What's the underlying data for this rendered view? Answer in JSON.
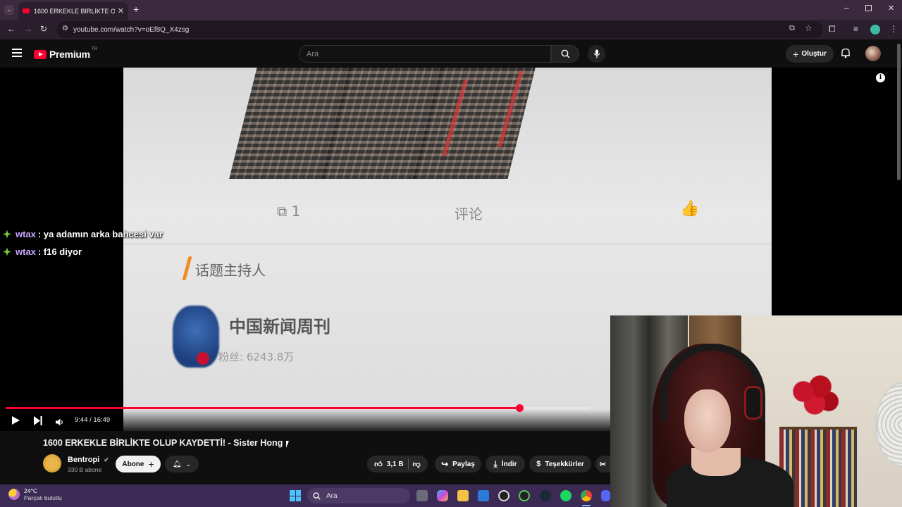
{
  "browser": {
    "tab_title": "1600 ERKEKLE BİRLİKTE OLUP KAYDETTİ! - Sister Hong",
    "url": "youtube.com/watch?v=oEf8Q_X4zsg"
  },
  "youtube": {
    "logo_text": "Premium",
    "logo_region": "TR",
    "search_placeholder": "Ara",
    "create_label": "Oluştur"
  },
  "video_overlay": {
    "cn_share": "1",
    "cn_comment": "评论",
    "cn_host": "话题主持人",
    "cn_source": "中国新闻周刊",
    "cn_followers": "粉丝: 6243.8万"
  },
  "player": {
    "time": "9:44 / 16:49",
    "progress": 0.88
  },
  "chat": [
    {
      "user": "wtax",
      "message": ": ya adamın arka bahcesi var"
    },
    {
      "user": "wtax",
      "message": ": f16 diyor"
    }
  ],
  "video": {
    "title": "1600 ERKEKLE BİRLİKTE OLUP KAYDETTİ! - Sister Hong",
    "channel": "Bentropi",
    "subscribers": "330 B abone",
    "subscribe_label": "Abone",
    "likes": "3,1 B",
    "share_label": "Paylaş",
    "download_label": "İndir",
    "thanks_label": "Teşekkürler"
  },
  "taskbar": {
    "temperature": "24°C",
    "weather": "Parçalı bulutlu",
    "search_label": "Ara"
  },
  "colors": {
    "accent_red": "#ff0033",
    "chat_user": "#c9a8ff",
    "taskbar": "#3a2a54"
  }
}
